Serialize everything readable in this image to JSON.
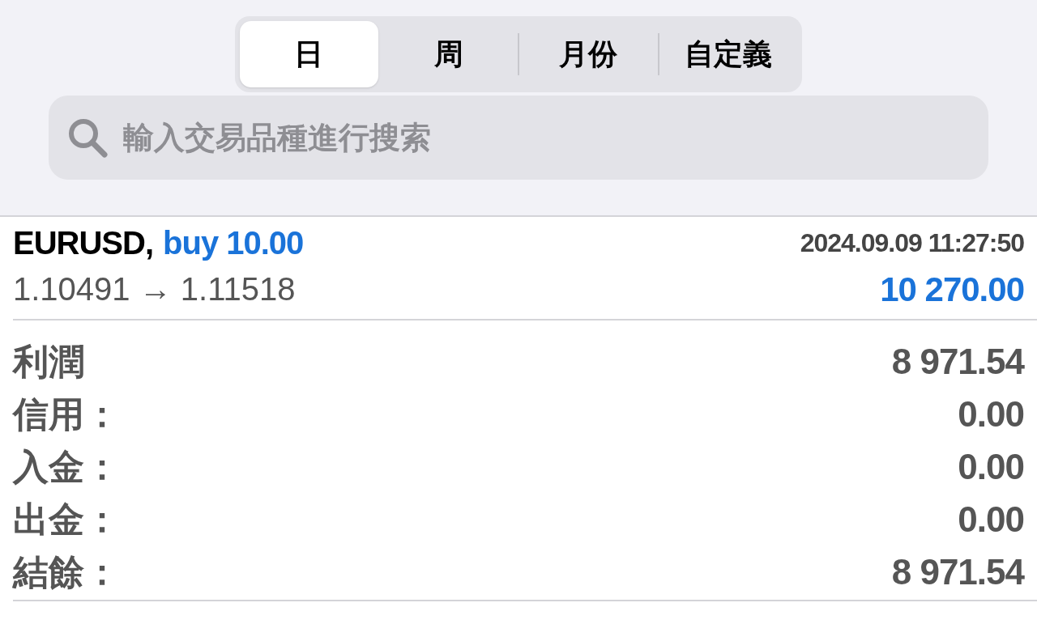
{
  "tabs": [
    {
      "label": "日",
      "selected": true
    },
    {
      "label": "周",
      "selected": false
    },
    {
      "label": "月份",
      "selected": false
    },
    {
      "label": "自定義",
      "selected": false
    }
  ],
  "search": {
    "placeholder": "輸入交易品種進行搜索"
  },
  "trade": {
    "symbol": "EURUSD,",
    "direction": "buy 10.00",
    "time": "2024.09.09 11:27:50",
    "prices": "1.10491 → 1.11518",
    "profit": "10 270.00"
  },
  "summary": [
    {
      "label": "利潤",
      "value": "8 971.54"
    },
    {
      "label": "信用：",
      "value": "0.00"
    },
    {
      "label": "入金：",
      "value": "0.00"
    },
    {
      "label": "出金：",
      "value": "0.00"
    },
    {
      "label": "結餘：",
      "value": "8 971.54"
    }
  ]
}
